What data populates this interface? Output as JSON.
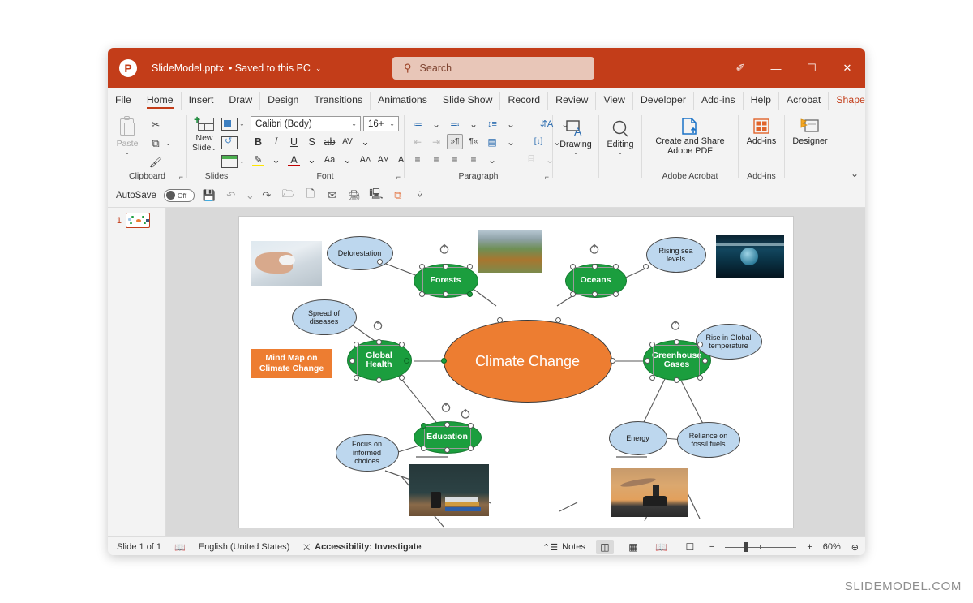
{
  "app": {
    "logo_glyph": "P",
    "document_title": "SlideModel.pptx",
    "save_state": "• Saved to this PC",
    "title_chevron": "⌄"
  },
  "search": {
    "placeholder": "Search",
    "icon": "search-icon"
  },
  "window_controls": {
    "pen": "✐",
    "minimize": "—",
    "maximize": "☐",
    "close": "✕"
  },
  "ribbon": {
    "tabs": [
      {
        "label": "File",
        "active": false
      },
      {
        "label": "Home",
        "active": true
      },
      {
        "label": "Insert",
        "active": false
      },
      {
        "label": "Draw",
        "active": false
      },
      {
        "label": "Design",
        "active": false
      },
      {
        "label": "Transitions",
        "active": false
      },
      {
        "label": "Animations",
        "active": false
      },
      {
        "label": "Slide Show",
        "active": false
      },
      {
        "label": "Record",
        "active": false
      },
      {
        "label": "Review",
        "active": false
      },
      {
        "label": "View",
        "active": false
      },
      {
        "label": "Developer",
        "active": false
      },
      {
        "label": "Add-ins",
        "active": false
      },
      {
        "label": "Help",
        "active": false
      },
      {
        "label": "Acrobat",
        "active": false
      },
      {
        "label": "Shape Format",
        "active": false
      }
    ],
    "overflow_chevron": "›",
    "collapse_chevron": "⌄",
    "groups": {
      "clipboard": {
        "label": "Clipboard",
        "launcher": "⌐",
        "paste": "Paste",
        "paste_chevron": "⌄",
        "cut": "✂",
        "copy": "⧉",
        "copy_chevron": "⌄",
        "format_painter": "🖌"
      },
      "slides": {
        "label": "Slides",
        "new_slide_line1": "New",
        "new_slide_line2": "Slide",
        "new_slide_chevron": "⌄",
        "layout_chevron": "⌄",
        "reset": "↺",
        "section_chevron": "⌄"
      },
      "font": {
        "label": "Font",
        "launcher": "⌐",
        "font_name": "Calibri (Body)",
        "font_size": "16+",
        "dropdown_chevron": "⌄",
        "bold": "B",
        "italic": "I",
        "underline": "U",
        "shadow": "S",
        "strikethrough": "ab",
        "char_spacing": "AV",
        "text_highlight": "🖊",
        "font_color": "A",
        "change_case": "Aa",
        "increase_size": "A˄",
        "decrease_size": "A˅",
        "clear_formatting": "A"
      },
      "paragraph": {
        "label": "Paragraph",
        "launcher": "⌐",
        "bullets": "≔",
        "numbering": "≕",
        "line_spacing": "↕≡",
        "decrease_indent": "⇤",
        "increase_indent": "⇥",
        "ltr_text": "»¶",
        "rtl_text": "¶«",
        "columns": "▤",
        "align_left": "≡",
        "align_center": "≡",
        "align_right": "≡",
        "justify": "≡",
        "text_direction": "⇵A",
        "align_text": "[↕]",
        "smartart": "⌸"
      },
      "drawing": {
        "label": "Drawing",
        "chevron": "⌄"
      },
      "editing": {
        "label": "Editing",
        "chevron": "⌄"
      },
      "acrobat": {
        "label": "Adobe Acrobat",
        "button_line1": "Create and Share",
        "button_line2": "Adobe PDF"
      },
      "addins": {
        "label": "Add-ins",
        "button": "Add-ins"
      },
      "designer": {
        "button": "Designer"
      }
    }
  },
  "quick_access": {
    "autosave_label": "AutoSave",
    "autosave_state": "Off",
    "save": "💾",
    "undo": "↶",
    "undo_chevron": "⌄",
    "redo": "↷",
    "open": "🗁",
    "new": "🗋",
    "email": "✉",
    "print_preview": "🖨",
    "start_show": "🖳",
    "duplicate": "⧉",
    "more_chevron": "⩒"
  },
  "thumbnails": {
    "slides": [
      {
        "number": "1"
      }
    ]
  },
  "status_bar": {
    "slide_counter": "Slide 1 of 1",
    "notes_icon_label": "book-icon",
    "language": "English (United States)",
    "accessibility": "Accessibility: Investigate",
    "notes": "Notes",
    "view_normal": "normal-view-icon",
    "view_sorter": "slide-sorter-icon",
    "view_reading": "reading-view-icon",
    "view_show": "slide-show-icon",
    "zoom_out": "−",
    "zoom_in": "+",
    "zoom_level": "60%",
    "fit_slide": "⊕"
  },
  "watermark": "SLIDEMODEL.COM",
  "slide": {
    "orange_label": "Mind Map on\nClimate Change",
    "orange_label_line1": "Mind Map on",
    "orange_label_line2": "Climate Change",
    "center_node": "Climate Change",
    "green_nodes": [
      {
        "id": "forests",
        "label": "Forests",
        "selected": true
      },
      {
        "id": "oceans",
        "label": "Oceans",
        "selected": true
      },
      {
        "id": "global-health",
        "label": "Global\nHealth",
        "line1": "Global",
        "line2": "Health",
        "selected": true
      },
      {
        "id": "greenhouse-gases",
        "label": "Greenhouse\nGases",
        "line1": "Greenhouse",
        "line2": "Gases",
        "selected": true
      },
      {
        "id": "education",
        "label": "Education",
        "selected": true
      }
    ],
    "blue_nodes": [
      {
        "id": "deforestation",
        "label": "Deforestation"
      },
      {
        "id": "rising-sea-levels",
        "line1": "Rising sea",
        "line2": "levels"
      },
      {
        "id": "spread-of-diseases",
        "line1": "Spread of",
        "line2": "diseases"
      },
      {
        "id": "rise-in-global-temperature",
        "line1": "Rise in Global",
        "line2": "temperature"
      },
      {
        "id": "focus-on-informed-choices",
        "line1": "Focus on",
        "line2": "informed",
        "line3": "choices"
      },
      {
        "id": "energy",
        "label": "Energy"
      },
      {
        "id": "reliance-on-fossil-fuels",
        "line1": "Reliance on",
        "line2": "fossil fuels"
      }
    ],
    "photos": [
      {
        "id": "hand-photo"
      },
      {
        "id": "forest-hillside-photo"
      },
      {
        "id": "underwater-globe-photo"
      },
      {
        "id": "classroom-books-photo"
      },
      {
        "id": "factory-smokestack-photo"
      }
    ]
  },
  "colors": {
    "brand_red": "#c33d19",
    "green_node": "#1b9e3e",
    "blue_node": "#bdd7ee",
    "orange_center": "#ed7d31"
  }
}
